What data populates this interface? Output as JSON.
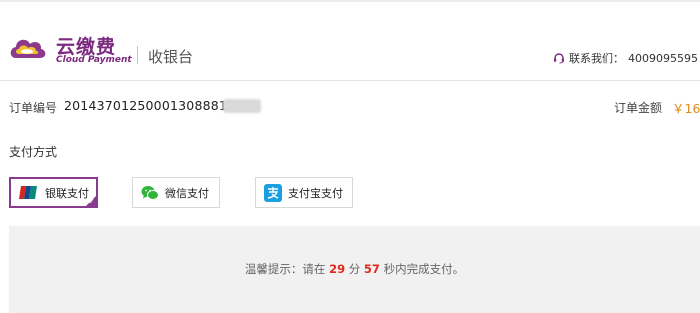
{
  "brand": {
    "name": "云缴费",
    "subtitle": "Cloud Payment",
    "color": "#7b2a7e"
  },
  "header": {
    "title": "收银台",
    "contact_label": "联系我们：",
    "contact_phone": "4009095595"
  },
  "order": {
    "number_label": "订单编号",
    "number_value": "20143701250001308881​8",
    "amount_label": "订单金额",
    "amount_value": "￥16"
  },
  "payment": {
    "section_label": "支付方式",
    "options": [
      {
        "label": "银联支付",
        "icon": "unionpay-icon",
        "selected": true
      },
      {
        "label": "微信支付",
        "icon": "wechat-icon",
        "selected": false
      },
      {
        "label": "支付宝支付",
        "icon": "alipay-icon",
        "selected": false
      }
    ]
  },
  "notice": {
    "prefix": "温馨提示：请在 ",
    "minutes": "29",
    "minutes_unit": " 分 ",
    "seconds": "57",
    "suffix": " 秒内完成支付。"
  },
  "colors": {
    "accent": "#8a3a8f",
    "amount": "#e08a1c",
    "countdown": "#e02a1c",
    "panel_bg": "#f1f1f2"
  }
}
